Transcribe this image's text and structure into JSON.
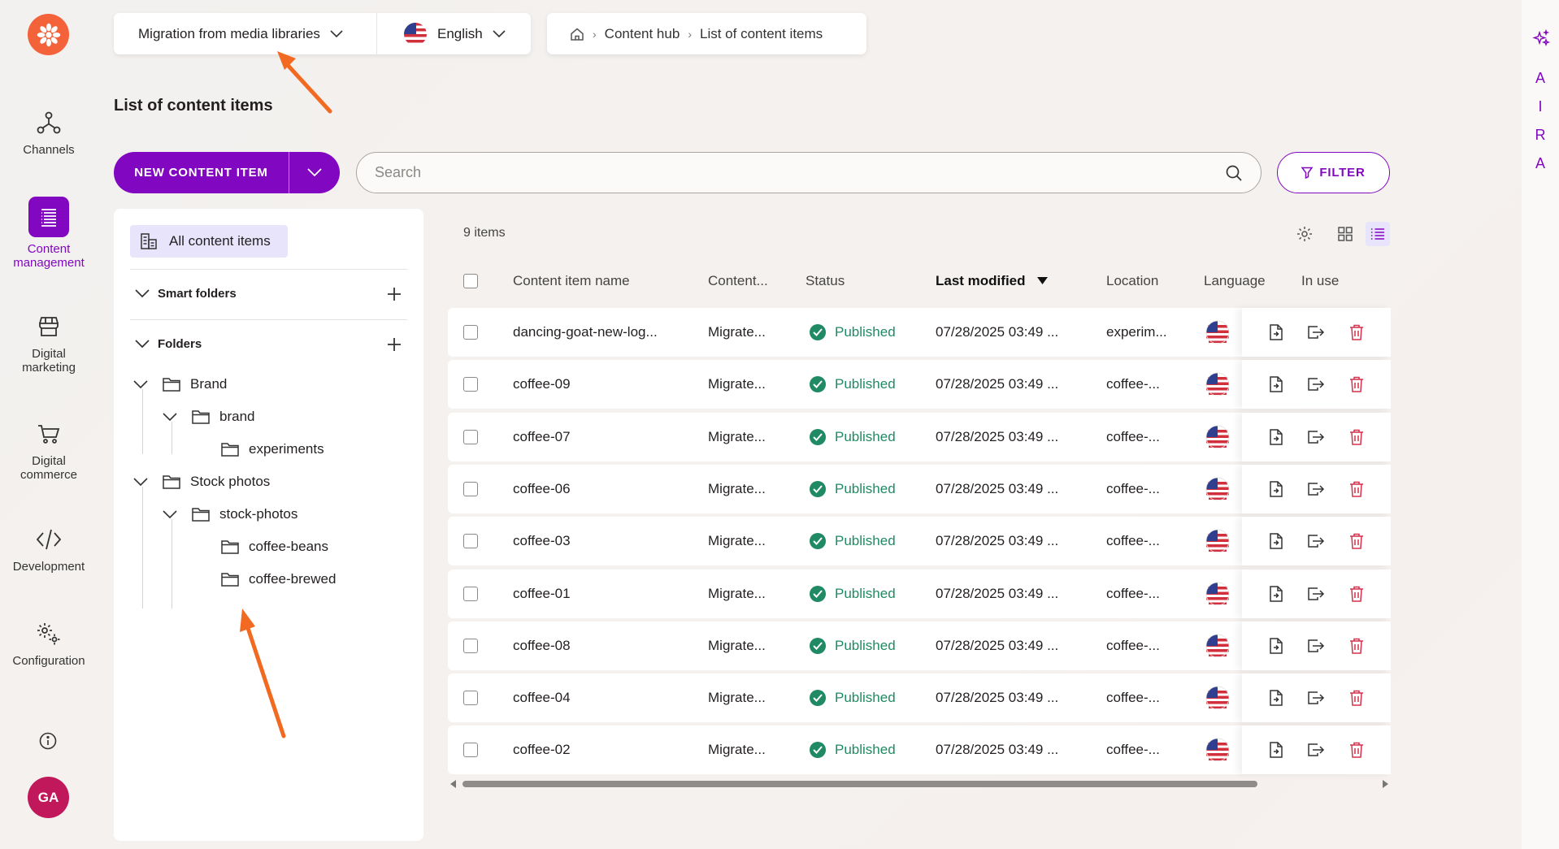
{
  "leftnav": {
    "items": [
      {
        "label": "Channels",
        "icon": "channels-icon"
      },
      {
        "label": "Content management",
        "icon": "content-management-icon"
      },
      {
        "label": "Digital marketing",
        "icon": "digital-marketing-icon"
      },
      {
        "label": "Digital commerce",
        "icon": "digital-commerce-icon"
      },
      {
        "label": "Development",
        "icon": "development-icon"
      },
      {
        "label": "Configuration",
        "icon": "configuration-icon"
      }
    ],
    "avatar_initials": "GA"
  },
  "topbar": {
    "channel": "Migration from media libraries",
    "language": "English",
    "breadcrumb": [
      "Content hub",
      "List of content items"
    ]
  },
  "page": {
    "title": "List of content items"
  },
  "actions": {
    "new_label": "NEW CONTENT ITEM",
    "search_placeholder": "Search",
    "filter_label": "FILTER"
  },
  "folders": {
    "all_items": "All content items",
    "smart_folders": "Smart folders",
    "folders_label": "Folders",
    "tree": [
      "Brand",
      "brand",
      "experiments",
      "Stock photos",
      "stock-photos",
      "coffee-beans",
      "coffee-brewed"
    ]
  },
  "table": {
    "count": "9 items",
    "columns": [
      "Content item name",
      "Content...",
      "Status",
      "Last modified",
      "Location",
      "Language",
      "In use"
    ],
    "rows": [
      {
        "name": "dancing-goat-new-log...",
        "type": "Migrate...",
        "status": "Published",
        "modified": "07/28/2025 03:49 ...",
        "location": "experim..."
      },
      {
        "name": "coffee-09",
        "type": "Migrate...",
        "status": "Published",
        "modified": "07/28/2025 03:49 ...",
        "location": "coffee-..."
      },
      {
        "name": "coffee-07",
        "type": "Migrate...",
        "status": "Published",
        "modified": "07/28/2025 03:49 ...",
        "location": "coffee-..."
      },
      {
        "name": "coffee-06",
        "type": "Migrate...",
        "status": "Published",
        "modified": "07/28/2025 03:49 ...",
        "location": "coffee-..."
      },
      {
        "name": "coffee-03",
        "type": "Migrate...",
        "status": "Published",
        "modified": "07/28/2025 03:49 ...",
        "location": "coffee-..."
      },
      {
        "name": "coffee-01",
        "type": "Migrate...",
        "status": "Published",
        "modified": "07/28/2025 03:49 ...",
        "location": "coffee-..."
      },
      {
        "name": "coffee-08",
        "type": "Migrate...",
        "status": "Published",
        "modified": "07/28/2025 03:49 ...",
        "location": "coffee-..."
      },
      {
        "name": "coffee-04",
        "type": "Migrate...",
        "status": "Published",
        "modified": "07/28/2025 03:49 ...",
        "location": "coffee-..."
      },
      {
        "name": "coffee-02",
        "type": "Migrate...",
        "status": "Published",
        "modified": "07/28/2025 03:49 ...",
        "location": "coffee-..."
      }
    ]
  },
  "aira": {
    "letters": [
      "A",
      "I",
      "R",
      "A"
    ]
  },
  "colors": {
    "accent": "#8107c1",
    "published": "#1f8a63",
    "logo": "#f4623a",
    "annotation": "#f26a21",
    "delete": "#d6304a"
  }
}
